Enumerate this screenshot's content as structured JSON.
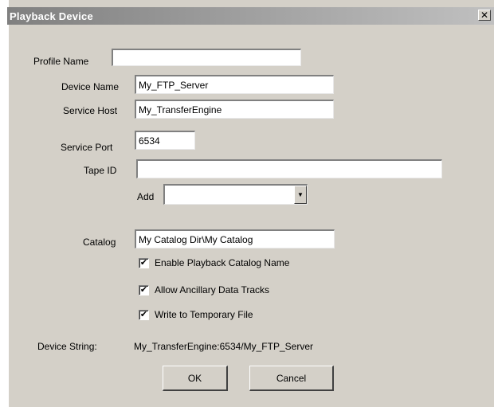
{
  "window": {
    "title": "Playback Device",
    "close_glyph": "✕"
  },
  "form": {
    "profile_name": {
      "label": "Profile Name",
      "value": ""
    },
    "device_name": {
      "label": "Device Name",
      "value": "My_FTP_Server"
    },
    "service_host": {
      "label": "Service Host",
      "value": "My_TransferEngine"
    },
    "service_port": {
      "label": "Service Port",
      "value": "6534"
    },
    "tape_id": {
      "label": "Tape ID",
      "value": ""
    },
    "add": {
      "label": "Add",
      "selected": "",
      "arrow": "▼"
    },
    "catalog": {
      "label": "Catalog",
      "value": "My Catalog Dir\\My Catalog"
    }
  },
  "checkboxes": [
    {
      "label": "Enable Playback Catalog Name",
      "checked": true,
      "mark": "✔"
    },
    {
      "label": "Allow Ancillary Data Tracks",
      "checked": true,
      "mark": "✔"
    },
    {
      "label": "Write to Temporary File",
      "checked": true,
      "mark": "✔"
    }
  ],
  "device_string": {
    "label": "Device String:",
    "value": "My_TransferEngine:6534/My_FTP_Server"
  },
  "buttons": {
    "ok": "OK",
    "cancel": "Cancel"
  }
}
